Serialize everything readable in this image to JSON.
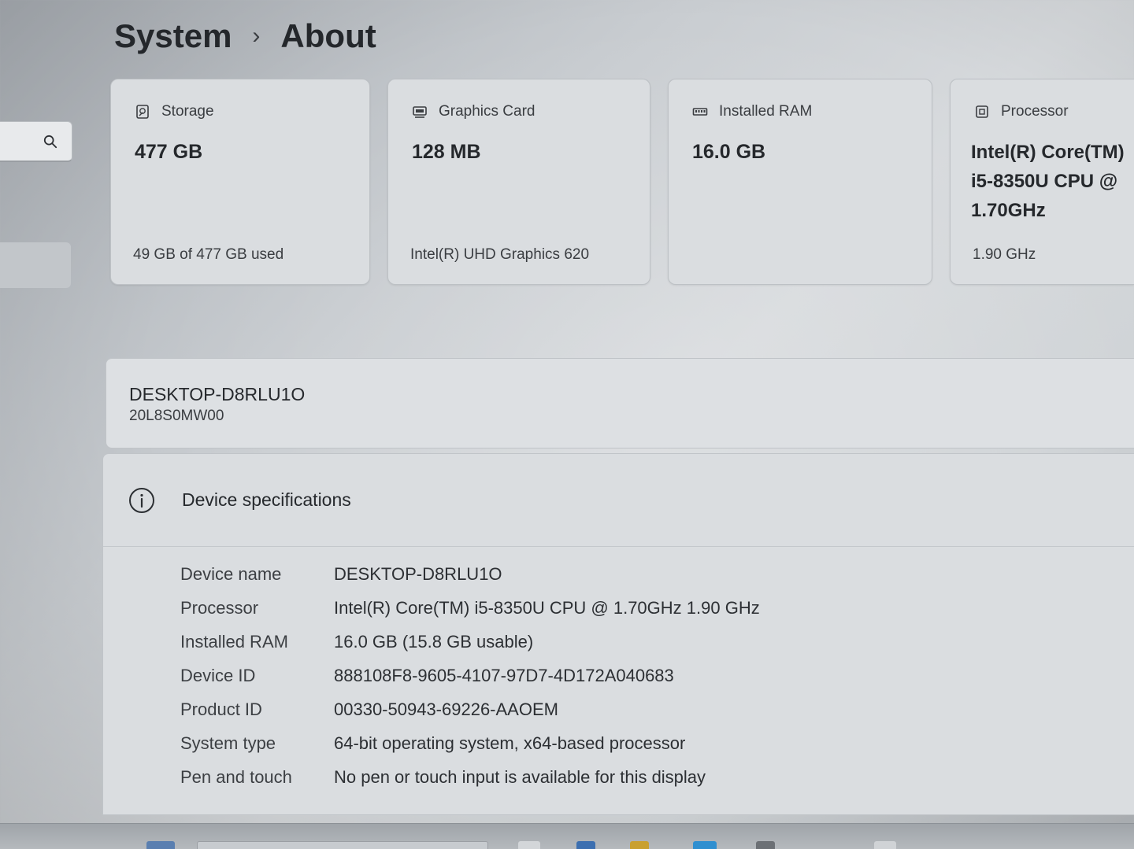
{
  "breadcrumb": {
    "parent": "System",
    "separator": "›",
    "current": "About"
  },
  "cards": {
    "storage": {
      "icon": "storage-icon",
      "title": "Storage",
      "value": "477 GB",
      "sub": "49 GB of 477 GB used"
    },
    "graphics": {
      "icon": "graphics-card-icon",
      "title": "Graphics Card",
      "value": "128 MB",
      "sub": "Intel(R) UHD Graphics 620"
    },
    "ram": {
      "icon": "ram-icon",
      "title": "Installed RAM",
      "value": "16.0 GB"
    },
    "processor": {
      "icon": "processor-icon",
      "title": "Processor",
      "value": "Intel(R) Core(TM) i5-8350U CPU @ 1.70GHz",
      "sub": "1.90 GHz"
    }
  },
  "device": {
    "name": "DESKTOP-D8RLU1O",
    "model": "20L8S0MW00"
  },
  "specs": {
    "title": "Device specifications",
    "rows": [
      {
        "label": "Device name",
        "value": "DESKTOP-D8RLU1O"
      },
      {
        "label": "Processor",
        "value": "Intel(R) Core(TM) i5-8350U CPU @ 1.70GHz   1.90 GHz"
      },
      {
        "label": "Installed RAM",
        "value": "16.0 GB (15.8 GB usable)"
      },
      {
        "label": "Device ID",
        "value": "888108F8-9605-4107-97D7-4D172A040683"
      },
      {
        "label": "Product ID",
        "value": "00330-50943-69226-AAOEM"
      },
      {
        "label": "System type",
        "value": "64-bit operating system, x64-based processor"
      },
      {
        "label": "Pen and touch",
        "value": "No pen or touch input is available for this display"
      }
    ]
  }
}
